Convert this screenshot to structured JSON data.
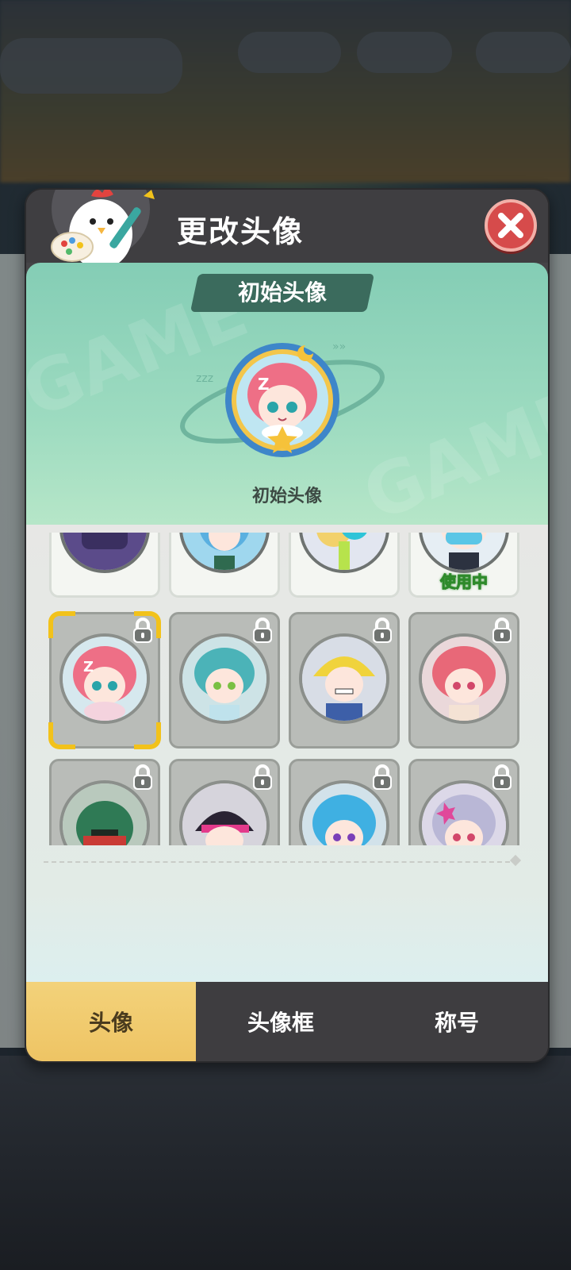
{
  "dialog": {
    "title": "更改头像",
    "close_label": "close"
  },
  "preview": {
    "tag": "初始头像",
    "avatar_name": "初始头像",
    "watermark": "GAME"
  },
  "grid": {
    "row1": [
      {
        "id": "avatar-purple-robot",
        "state": "owned"
      },
      {
        "id": "avatar-blue-mage",
        "state": "owned"
      },
      {
        "id": "avatar-goggles-kid",
        "state": "owned"
      },
      {
        "id": "avatar-masked-girl",
        "state": "owned",
        "status": "使用中"
      }
    ],
    "row2": [
      {
        "id": "avatar-pink-sleepy",
        "state": "locked",
        "selected": true
      },
      {
        "id": "avatar-teal-boy",
        "state": "locked"
      },
      {
        "id": "avatar-blonde-grin",
        "state": "locked"
      },
      {
        "id": "avatar-pink-girl",
        "state": "locked"
      }
    ],
    "row3": [
      {
        "id": "avatar-green-warrior",
        "state": "locked"
      },
      {
        "id": "avatar-visor-agent",
        "state": "locked"
      },
      {
        "id": "avatar-blue-hair-girl",
        "state": "locked"
      },
      {
        "id": "avatar-silver-star-girl",
        "state": "locked"
      }
    ]
  },
  "tabs": [
    {
      "label": "头像",
      "active": true
    },
    {
      "label": "头像框",
      "active": false
    },
    {
      "label": "称号",
      "active": false
    }
  ],
  "colors": {
    "accent_tab": "#eec464",
    "close_button": "#d64b4b",
    "in_use_outline": "#2e8a2b",
    "selection_corner": "#f2c21b"
  }
}
